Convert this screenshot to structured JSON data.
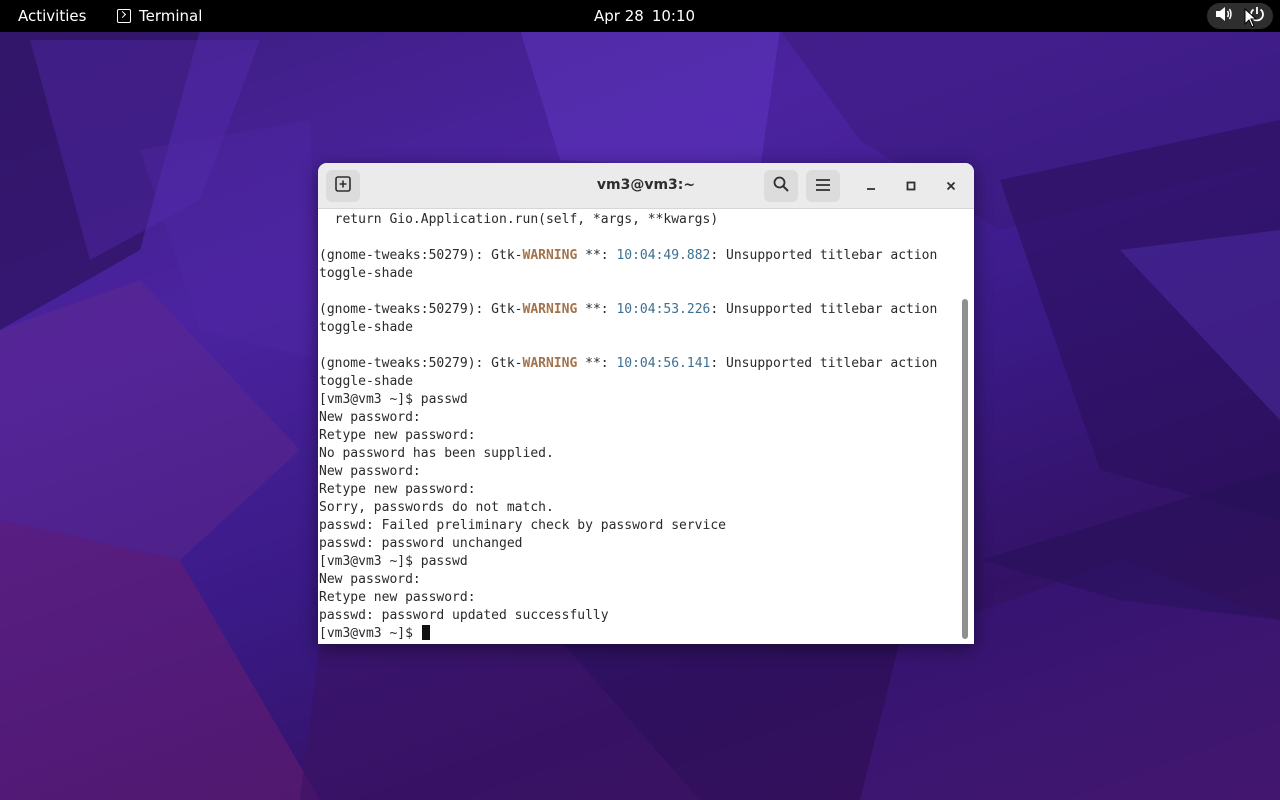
{
  "topbar": {
    "activities_label": "Activities",
    "app_name": "Terminal",
    "date": "Apr 28",
    "time": "10:10",
    "status_icons": [
      "volume-icon",
      "power-icon"
    ]
  },
  "window": {
    "title": "vm3@vm3:~",
    "new_tab_icon": "new-tab-icon",
    "search_icon": "search-icon",
    "menu_icon": "hamburger-menu-icon",
    "minimize_icon": "minimize-icon",
    "maximize_icon": "maximize-icon",
    "close_icon": "close-icon"
  },
  "terminal": {
    "l0": "  return Gio.Application.run(self, *args, **kwargs)",
    "w1_pre": "(gnome-tweaks:50279): Gtk-",
    "warn_word": "WARNING",
    "w_mid": " **: ",
    "w1_ts": "10:04:49.882",
    "w_post": ": Unsupported titlebar action",
    "w_cont": "toggle-shade",
    "w2_pre": "(gnome-tweaks:50279): Gtk-",
    "w2_ts": "10:04:53.226",
    "w3_pre": "(gnome-tweaks:50279): Gtk-",
    "w3_ts": "10:04:56.141",
    "l10": "[vm3@vm3 ~]$ passwd",
    "l11": "New password: ",
    "l12": "Retype new password: ",
    "l13": "No password has been supplied.",
    "l14": "New password: ",
    "l15": "Retype new password: ",
    "l16": "Sorry, passwords do not match.",
    "l17": "passwd: Failed preliminary check by password service",
    "l18": "passwd: password unchanged",
    "l19": "[vm3@vm3 ~]$ passwd",
    "l20": "New password: ",
    "l21": "Retype new password: ",
    "l22": "passwd: password updated successfully",
    "prompt": "[vm3@vm3 ~]$ "
  }
}
